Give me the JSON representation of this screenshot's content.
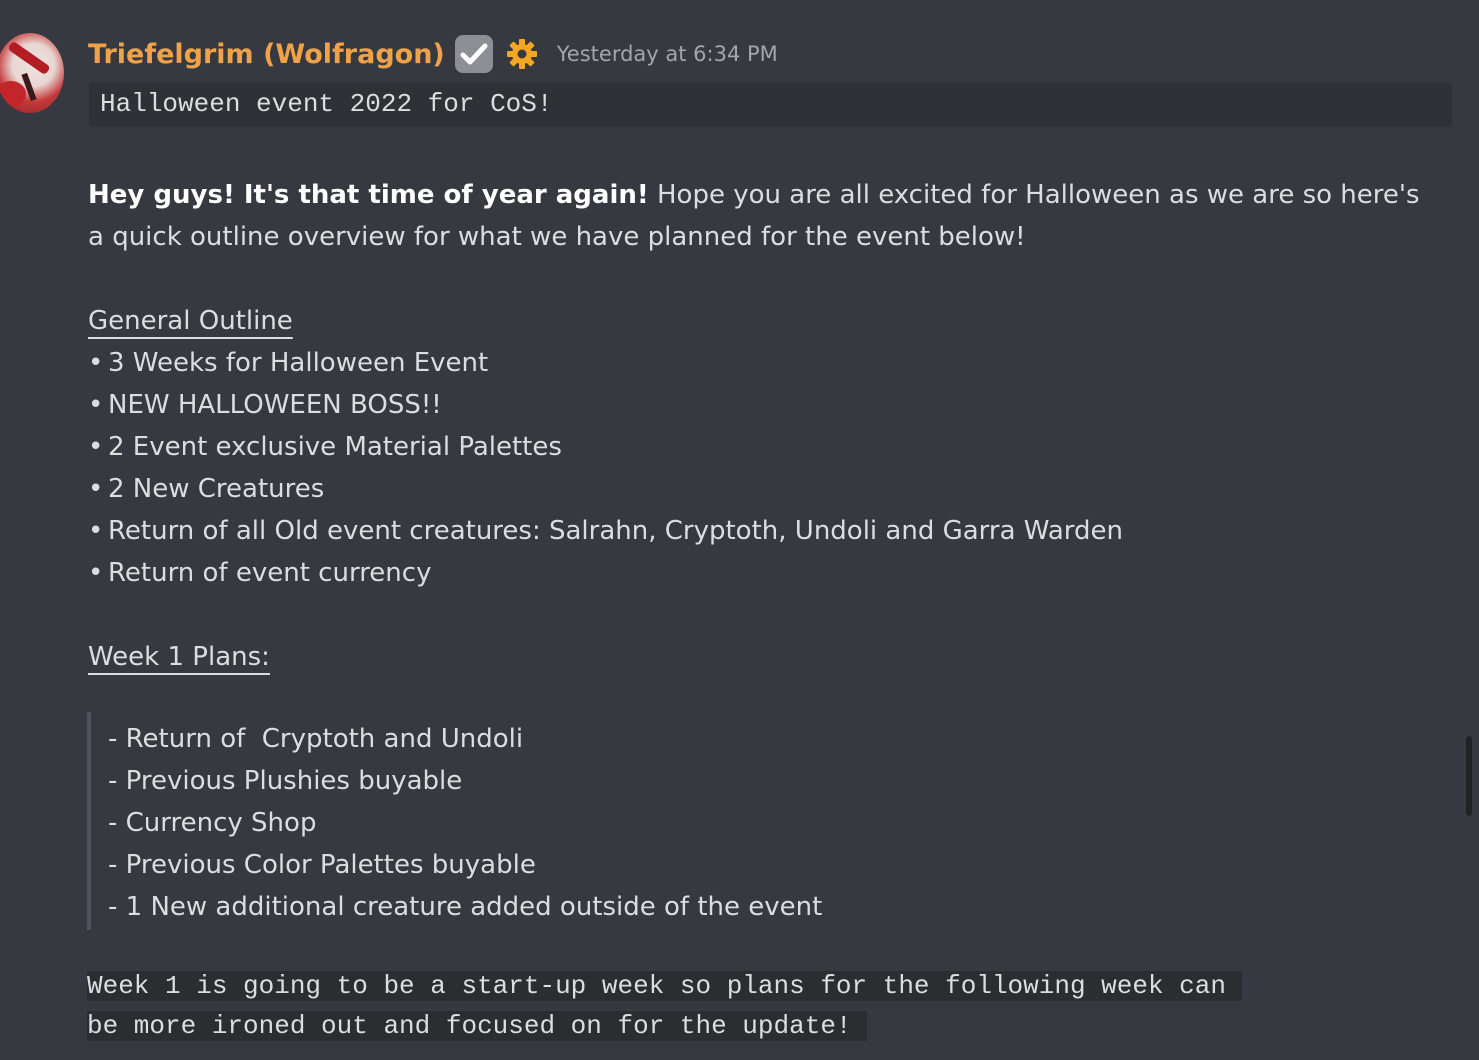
{
  "message": {
    "author": "Triefelgrim (Wolfragon)",
    "timestamp": "Yesterday at 6:34 PM",
    "title_code": "Halloween event 2022 for CoS!",
    "intro_bold": "Hey guys! It's that time of year again!",
    "intro_text": " Hope you are all excited for Halloween as we are so here's a quick outline overview for what we have planned for the event below!",
    "general_outline": {
      "heading": "General Outline",
      "items": [
        "3 Weeks for Halloween Event",
        "NEW HALLOWEEN BOSS!!",
        "2 Event exclusive Material Palettes",
        "2 New Creatures",
        "Return of all Old event creatures: Salrahn, Cryptoth, Undoli and Garra Warden",
        "Return of event currency"
      ]
    },
    "week1": {
      "heading": "Week 1 Plans:",
      "items": [
        "- Return of  Cryptoth and Undoli",
        "- Previous Plushies buyable",
        "- Currency Shop",
        "- Previous Color Palettes buyable",
        "- 1 New additional creature added outside of the event"
      ]
    },
    "footer_code": [
      "Week 1 is going to be a start-up week so plans for the following week can ",
      "be more ironed out and focused on for the update! "
    ]
  },
  "colors": {
    "background": "#36393f",
    "username": "#f0a24a",
    "code_bg": "#2f3136"
  },
  "icons": {
    "badge": "check-icon",
    "role": "gear-icon"
  }
}
